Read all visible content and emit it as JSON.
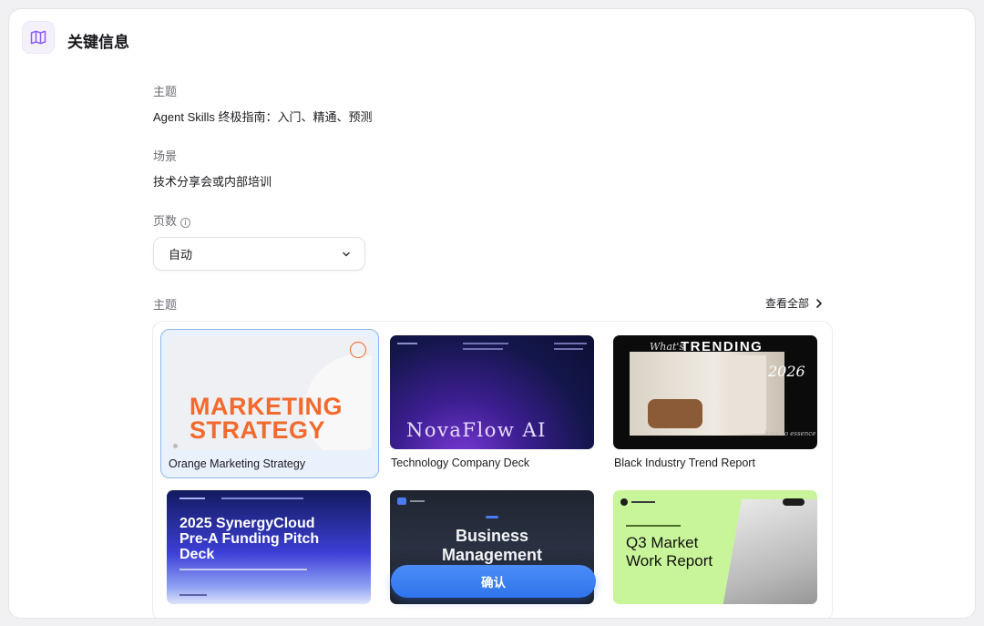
{
  "header": {
    "title": "关键信息",
    "icon": "map-icon"
  },
  "topic": {
    "label": "主题",
    "value": "Agent Skills 终极指南：入门、精通、预测"
  },
  "scene": {
    "label": "场景",
    "value": "技术分享会或内部培训"
  },
  "pages": {
    "label": "页数",
    "selected": "自动",
    "info_icon": "info-icon"
  },
  "themes": {
    "label": "主题",
    "view_all": "查看全部",
    "items": [
      {
        "title": "Orange Marketing Strategy",
        "thumb_line1": "MARKETING",
        "thumb_line2": "STRATEGY",
        "selected": true
      },
      {
        "title": "Technology Company Deck",
        "thumb_text": "NovaFlow AI"
      },
      {
        "title": "Black Industry Trend Report",
        "thumb_small": "What's",
        "thumb_big": "TRENDING",
        "thumb_year": "2026",
        "thumb_footer": "back to essence"
      },
      {
        "title": "",
        "thumb_line1": "2025 SynergyCloud",
        "thumb_line2": "Pre-A Funding Pitch",
        "thumb_line3": "Deck"
      },
      {
        "title": "",
        "thumb_line1": "Business",
        "thumb_line2": "Management"
      },
      {
        "title": "",
        "thumb_line1": "Q3 Market",
        "thumb_line2": "Work Report"
      }
    ]
  },
  "confirm_button": "确认",
  "colors": {
    "accent": "#2f74ec",
    "orange": "#f26a2e",
    "selected_bg": "#e8f1fc"
  }
}
